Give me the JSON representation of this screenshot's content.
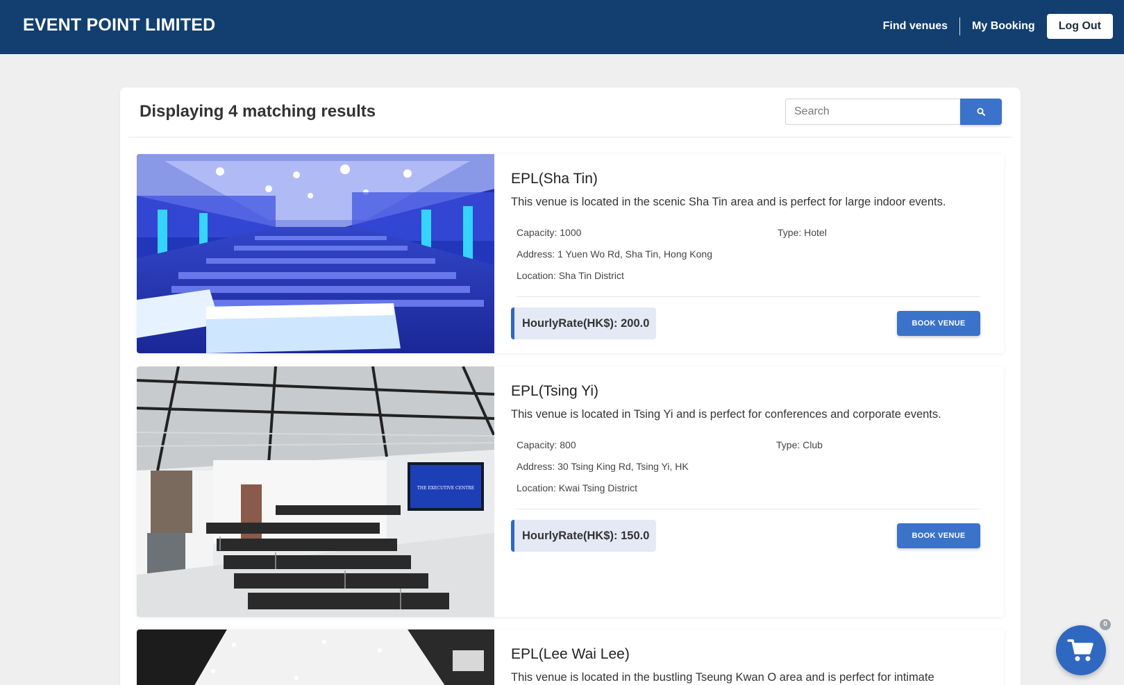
{
  "header": {
    "brand": "EVENT POINT LIMITED",
    "nav": {
      "find_venues": "Find venues",
      "my_booking": "My Booking",
      "logout": "Log Out"
    },
    "bg_color": "#123f6f"
  },
  "results": {
    "title": "Displaying 4 matching results",
    "search_placeholder": "Search",
    "search_icon": "search-icon"
  },
  "venues": [
    {
      "name": "EPL(Sha Tin)",
      "description": "This venue is located in the scenic Sha Tin area and is perfect for large indoor events.",
      "capacity": "Capacity: 1000",
      "type": "Type: Hotel",
      "address": "Address: 1 Yuen Wo Rd, Sha Tin, Hong Kong",
      "location": "Location: Sha Tin District",
      "rate": "HourlyRate(HK$): 200.0",
      "button": "BOOK VENUE"
    },
    {
      "name": "EPL(Tsing Yi)",
      "description": "This venue is located in Tsing Yi and is perfect for conferences and corporate events.",
      "capacity": "Capacity: 800",
      "type": "Type: Club",
      "address": "Address: 30 Tsing King Rd, Tsing Yi, HK",
      "location": "Location: Kwai Tsing District",
      "rate": "HourlyRate(HK$): 150.0",
      "button": "BOOK VENUE",
      "screen_text": "THE EXECUTIVE CENTRE"
    },
    {
      "name": "EPL(Lee Wai Lee)",
      "description": "This venue is located in the bustling Tseung Kwan O area and is perfect for intimate"
    }
  ],
  "cart": {
    "count": "0",
    "icon": "shopping-cart-icon"
  },
  "colors": {
    "accent": "#3a73c9",
    "rate_bg": "#e4e9f5",
    "page_bg": "#efefef"
  }
}
